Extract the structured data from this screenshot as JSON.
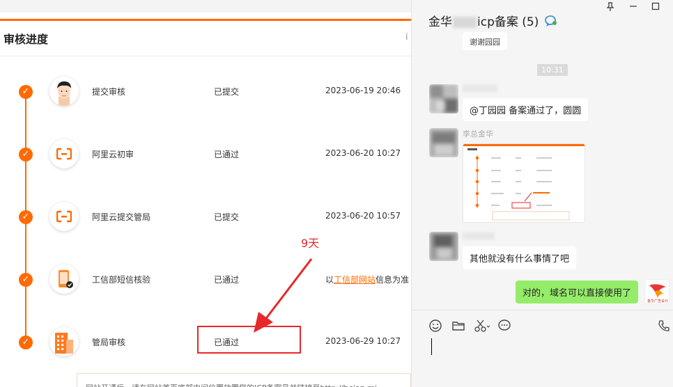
{
  "progress": {
    "header_title": "审核进度",
    "header_cut": "i",
    "steps": [
      {
        "name": "提交审核",
        "status": "已提交",
        "time": "2023-06-19 20:46",
        "icon": "person-avatar-icon"
      },
      {
        "name": "阿里云初审",
        "status": "已通过",
        "time": "2023-06-20 10:27",
        "icon": "aliyun-logo-icon"
      },
      {
        "name": "阿里云提交管局",
        "status": "已提交",
        "time": "2023-06-20 10:57",
        "icon": "aliyun-logo-icon"
      },
      {
        "name": "工信部短信核验",
        "status": "已通过",
        "time_prefix": "以",
        "time_link": "工信部网站",
        "time_suffix": "信息为准",
        "icon": "phone-verify-icon"
      },
      {
        "name": "管局审核",
        "status": "已通过",
        "time": "2023-06-29 10:27",
        "icon": "building-icon"
      }
    ],
    "annotation": "9天",
    "bottom_tip": "网站开通后，请在网站首页底部中间位置放置您的ICP备案号并链接至http://beian.mi"
  },
  "chat": {
    "title_prefix": "金华",
    "title_suffix": "icp备案 (5)",
    "time_chip": "10:31",
    "partial_top": "谢谢园园",
    "messages": [
      {
        "text": "@丁园园 备案通过了，圆圆"
      },
      {
        "sender": "李总金华"
      },
      {
        "text": "其他就没有什么事情了吧"
      },
      {
        "text": "对的，域名可以直接使用了"
      }
    ],
    "self_avatar_text": "金华广告设计"
  },
  "colors": {
    "accent": "#ff6a00",
    "annotation": "#e8272a",
    "self_bubble": "#95ec69"
  }
}
